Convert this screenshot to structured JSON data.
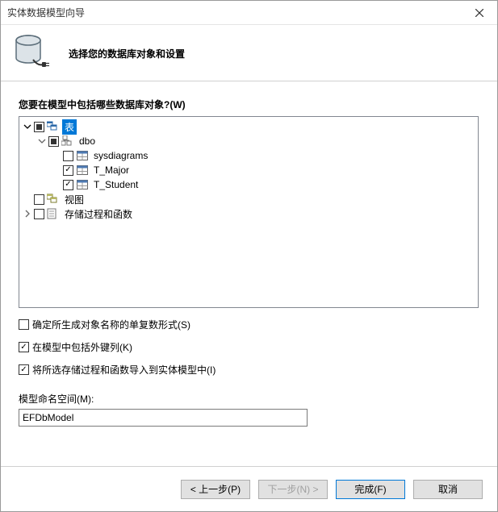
{
  "window": {
    "title": "实体数据模型向导"
  },
  "header": {
    "subtitle": "选择您的数据库对象和设置"
  },
  "tree_label": "您要在模型中包括哪些数据库对象?(W)",
  "tree": {
    "tables": "表",
    "dbo": "dbo",
    "sysdiagrams": "sysdiagrams",
    "t_major": "T_Major",
    "t_student": "T_Student",
    "views": "视图",
    "procs": "存储过程和函数"
  },
  "options": {
    "pluralize": "确定所生成对象名称的单复数形式(S)",
    "include_fk": "在模型中包括外键列(K)",
    "import_sp": "将所选存储过程和函数导入到实体模型中(I)"
  },
  "namespace": {
    "label": "模型命名空间(M):",
    "value": "EFDbModel"
  },
  "buttons": {
    "back": "< 上一步(P)",
    "next": "下一步(N) >",
    "finish": "完成(F)",
    "cancel": "取消"
  }
}
